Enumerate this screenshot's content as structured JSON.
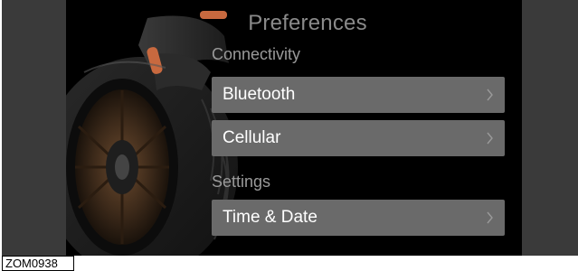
{
  "screen": {
    "title": "Preferences",
    "sections": [
      {
        "label": "Connectivity",
        "items": [
          {
            "label": "Bluetooth",
            "icon": "chevron-right-icon"
          },
          {
            "label": "Cellular",
            "icon": "chevron-right-icon"
          }
        ]
      },
      {
        "label": "Settings",
        "items": [
          {
            "label": "Time & Date",
            "icon": "chevron-right-icon"
          }
        ]
      }
    ]
  },
  "figure": {
    "label": "ZOM0938"
  },
  "colors": {
    "screen_background": "#000000",
    "row_background": "#6a6a6a",
    "title_text": "#8a8a8a",
    "section_text": "#9a9a9a",
    "row_text": "#ffffff",
    "bezel": "#3a3a3a",
    "accent_orange": "#c8693f"
  }
}
